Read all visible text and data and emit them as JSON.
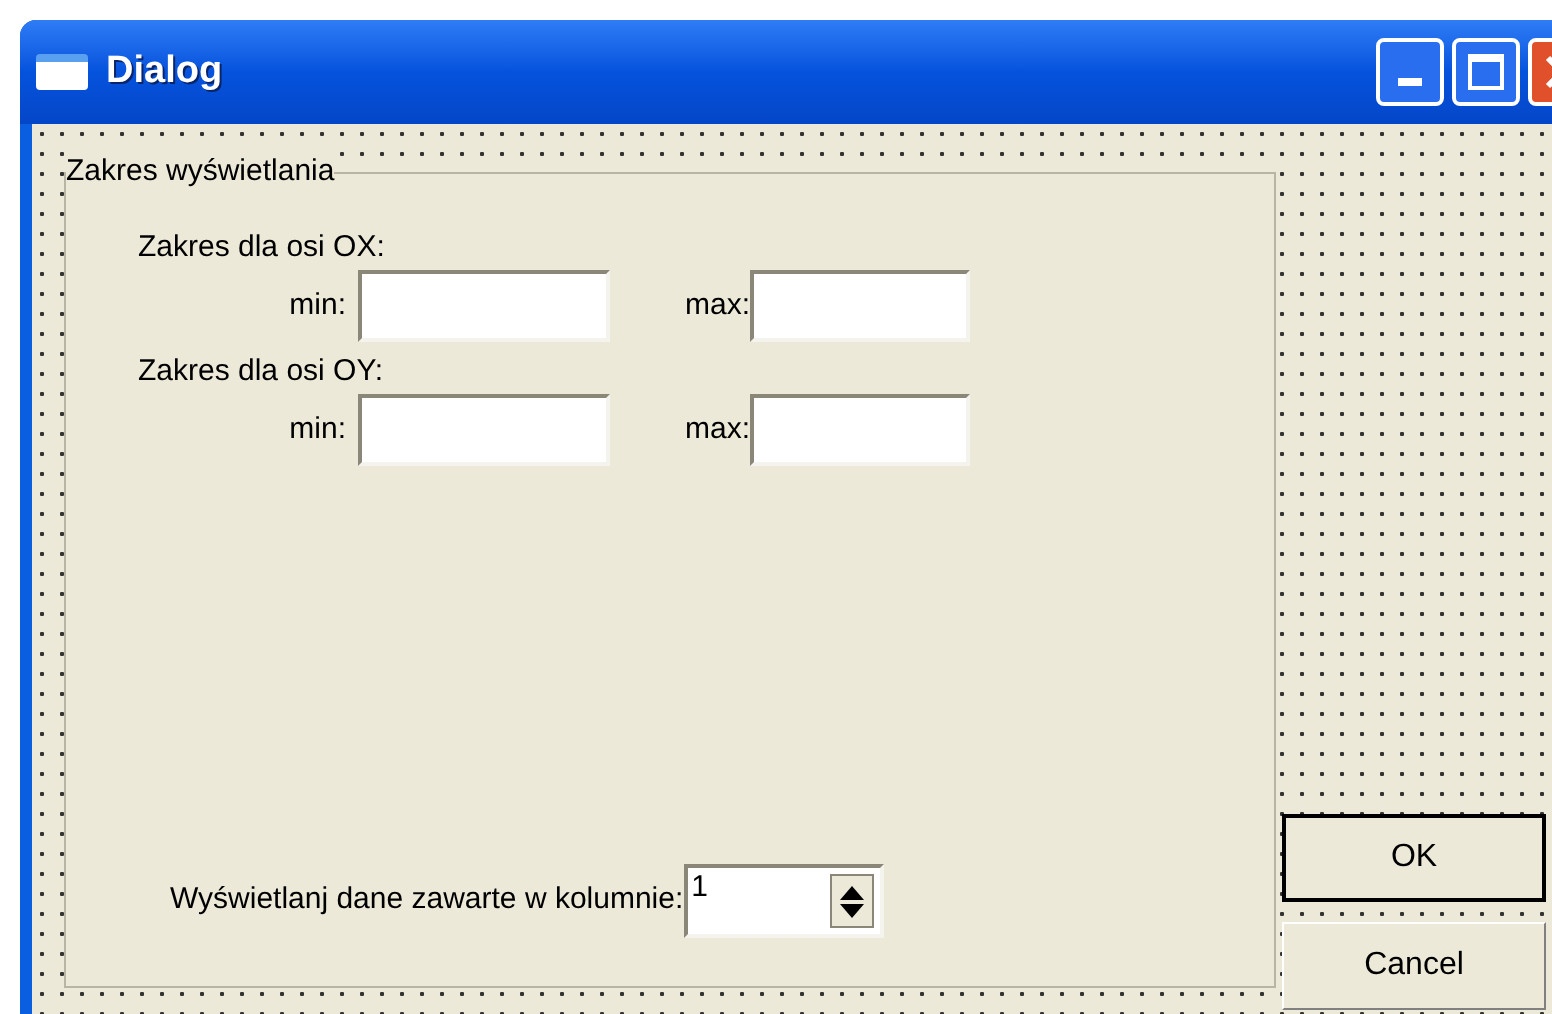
{
  "window": {
    "title": "Dialog"
  },
  "group": {
    "title": "Zakres wyświetlania",
    "axes": [
      {
        "label": "Zakres dla osi OX:",
        "min_label": "min:",
        "max_label": "max:"
      },
      {
        "label": "Zakres dla osi OY:",
        "min_label": "min:",
        "max_label": "max:"
      }
    ],
    "column": {
      "label": "Wyświetlanj dane zawarte w kolumnie:",
      "value": "1"
    }
  },
  "buttons": [
    {
      "label": "OK",
      "default": true
    },
    {
      "label": "Cancel",
      "default": false
    }
  ]
}
